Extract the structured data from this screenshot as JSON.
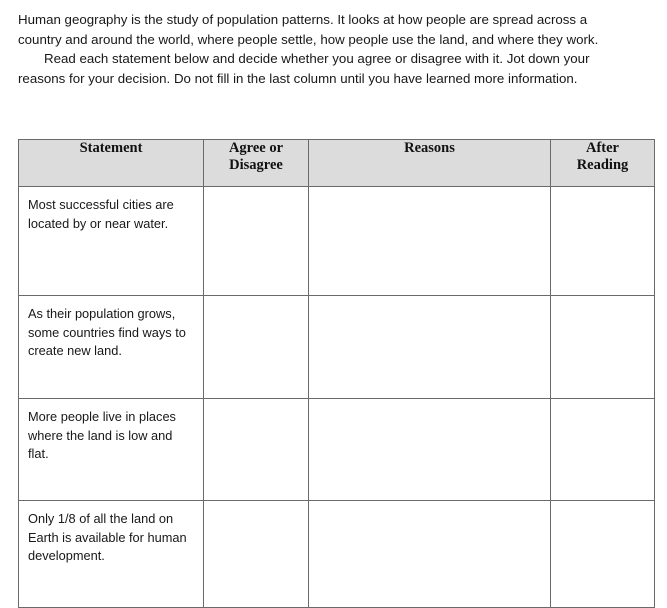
{
  "intro": {
    "paragraph1": "Human geography is the study of population patterns. It looks at how people are spread across a country and around the world, where people settle, how people use the land, and where they work.",
    "paragraph2": "Read each statement below and decide whether you agree or disagree with it. Jot down your reasons for your decision. Do not fill in the last column until you have learned more information."
  },
  "table": {
    "headers": {
      "statement": "Statement",
      "agree_or_disagree_line1": "Agree or",
      "agree_or_disagree_line2": "Disagree",
      "reasons": "Reasons",
      "after_reading_line1": "After",
      "after_reading_line2": "Reading"
    },
    "rows": [
      {
        "statement": "Most successful cities are located by or near water.",
        "agree_or_disagree": "",
        "reasons": "",
        "after_reading": ""
      },
      {
        "statement": "As their population grows, some countries find ways to create new land.",
        "agree_or_disagree": "",
        "reasons": "",
        "after_reading": ""
      },
      {
        "statement": "More people live in places where the land is low and flat.",
        "agree_or_disagree": "",
        "reasons": "",
        "after_reading": ""
      },
      {
        "statement": "Only 1/8 of all the land on Earth is available for human development.",
        "agree_or_disagree": "",
        "reasons": "",
        "after_reading": ""
      }
    ]
  },
  "colors": {
    "header_background": "#dcdcdc",
    "border": "#6a6a6a",
    "text": "#181818",
    "page_background": "#ffffff"
  }
}
